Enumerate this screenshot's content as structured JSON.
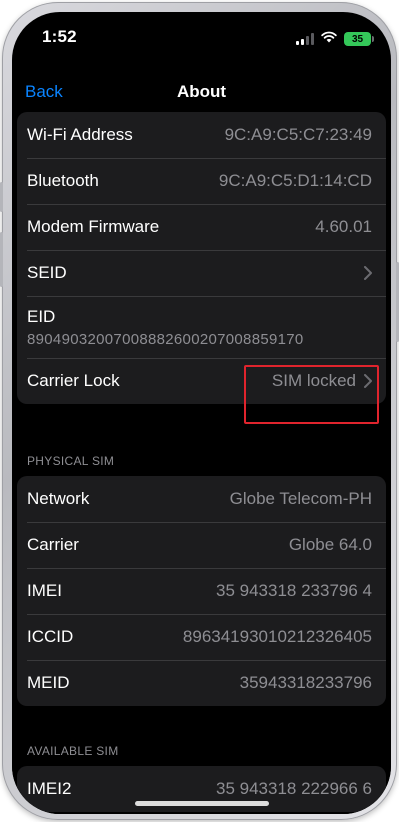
{
  "status_bar": {
    "time": "1:52",
    "battery_level": "35"
  },
  "nav": {
    "back_label": "Back",
    "title": "About"
  },
  "groups": {
    "device": [
      {
        "label": "Wi-Fi Address",
        "value": "9C:A9:C5:C7:23:49"
      },
      {
        "label": "Bluetooth",
        "value": "9C:A9:C5:D1:14:CD"
      },
      {
        "label": "Modem Firmware",
        "value": "4.60.01"
      },
      {
        "label": "SEID",
        "value": ""
      },
      {
        "label": "EID",
        "value": "89049032007008882600207008859170"
      },
      {
        "label": "Carrier Lock",
        "value": "SIM locked"
      }
    ],
    "physical_sim_header": "PHYSICAL SIM",
    "physical_sim": [
      {
        "label": "Network",
        "value": "Globe Telecom-PH"
      },
      {
        "label": "Carrier",
        "value": "Globe 64.0"
      },
      {
        "label": "IMEI",
        "value": "35 943318 233796 4"
      },
      {
        "label": "ICCID",
        "value": "89634193010212326405"
      },
      {
        "label": "MEID",
        "value": "35943318233796"
      }
    ],
    "available_sim_header": "AVAILABLE SIM",
    "available_sim": [
      {
        "label": "IMEI2",
        "value": "35 943318 222966 6"
      }
    ]
  },
  "colors": {
    "accent": "#0a84ff",
    "battery": "#34c759",
    "highlight": "#e0242d"
  },
  "icons": {
    "wifi": "wifi-icon",
    "signal": "cellular-signal-icon",
    "chevron": "chevron-right-icon"
  }
}
